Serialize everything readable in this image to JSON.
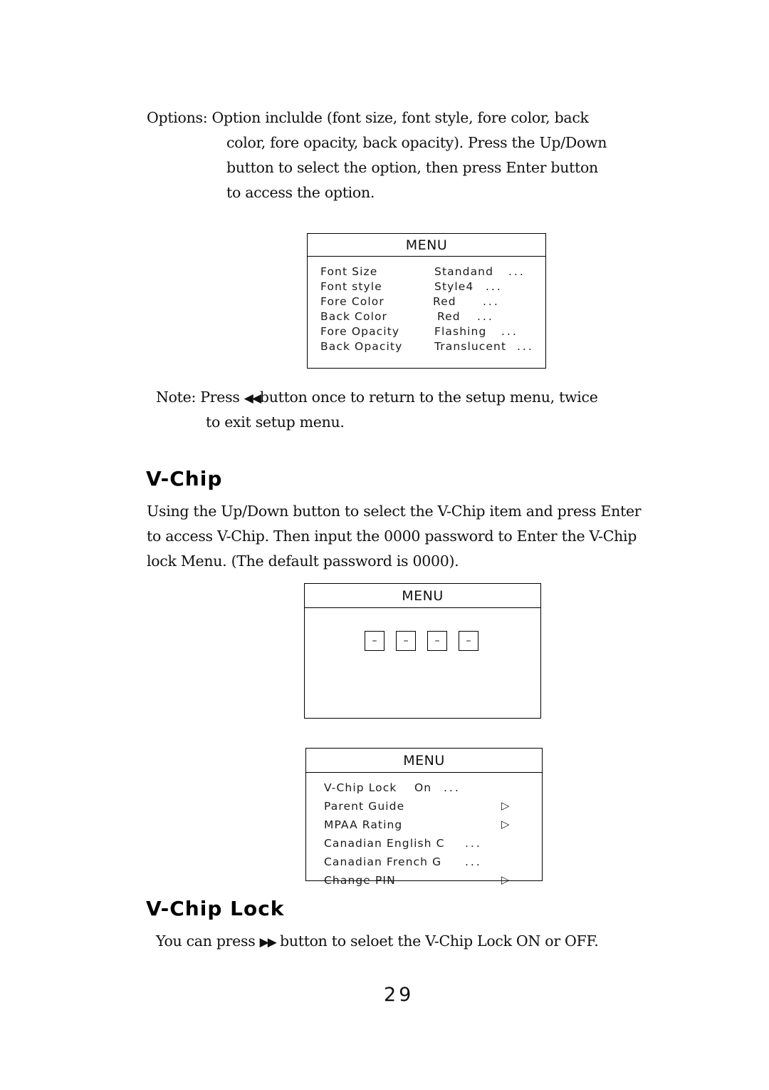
{
  "page": {
    "number": "29"
  },
  "options_paragraph": {
    "lines": [
      "Options: Option inclulde (font size, font style, fore color, back",
      "color, fore opacity, back opacity). Press  the Up/Down",
      "button to select  the option, then  press Enter button",
      "to access the option."
    ]
  },
  "font_menu": {
    "title": "MENU",
    "rows": [
      {
        "label": "Font  Size",
        "value": "Standand",
        "dots": "..."
      },
      {
        "label": "Font  style",
        "value": "Style4",
        "dots": "..."
      },
      {
        "label": "Fore  Color",
        "value": "Red",
        "dots": "..."
      },
      {
        "label": "Back Color",
        "value": "Red",
        "dots": "..."
      },
      {
        "label": "Fore  Opacity",
        "value": "Flashing",
        "dots": "..."
      },
      {
        "label": "Back Opacity",
        "value": "Translucent",
        "dots": "..."
      }
    ]
  },
  "note_paragraph": {
    "line1_pre": "Note: Press ",
    "rewind_icon": "◀◀",
    "line1_post": "button once to return to the setup menu, twice",
    "line2": "to exit setup menu."
  },
  "vchip_section": {
    "heading": "V-Chip",
    "lines": [
      "Using the Up/Down button to select the V-Chip item and press Enter",
      "to access V-Chip. Then input the 0000 password to Enter the V-Chip",
      "lock Menu. (The default password is 0000)."
    ]
  },
  "password_menu": {
    "title": "MENU",
    "pin_cells": [
      "–",
      "–",
      "–",
      "–"
    ]
  },
  "vchip_menu": {
    "title": "MENU",
    "rows": [
      {
        "label": "V-Chip Lock",
        "value": "On",
        "dots": "...",
        "arrow": ""
      },
      {
        "label": "Parent Guide",
        "value": "",
        "dots": "",
        "arrow": "▷"
      },
      {
        "label": "MPAA Rating",
        "value": "",
        "dots": "",
        "arrow": "▷"
      },
      {
        "label": "Canadian English C",
        "value": "",
        "dots": "...",
        "arrow": ""
      },
      {
        "label": "Canadian French  G",
        "value": "",
        "dots": "...",
        "arrow": ""
      },
      {
        "label": "Change PIN",
        "value": "",
        "dots": "",
        "arrow": "▷"
      }
    ]
  },
  "vchip_lock_section": {
    "heading": "V-Chip Lock",
    "line_pre": "You can press ",
    "ff_icon": "▶▶",
    "line_post": " button to seloet the V-Chip Lock ON or OFF."
  }
}
